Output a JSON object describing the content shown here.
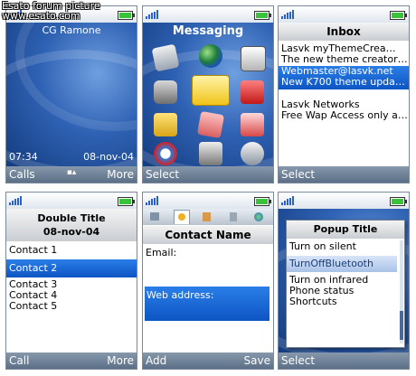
{
  "watermark": {
    "line1": "Esato forum picture",
    "line2": "www.esato.com"
  },
  "standby": {
    "operator": "CG Ramone",
    "time": "07:34",
    "date": "08-nov-04",
    "left_soft": "Calls",
    "right_soft": "More"
  },
  "messaging": {
    "title": "Messaging",
    "left_soft": "Select",
    "icons": [
      "contacts-icon",
      "globe-icon",
      "media-player-icon",
      "camera-icon",
      "envelope-icon",
      "organizer-icon",
      "folder-icon",
      "notes-icon",
      "calculator-icon",
      "sync-icon",
      "fm-radio-icon",
      "settings-icon"
    ]
  },
  "inbox": {
    "title": "Inbox",
    "items": [
      {
        "line1": "Lasvk myThemeCrea…",
        "line2": "The new theme creator…"
      },
      {
        "line1": "Webmaster@lasvk.net",
        "line2": "New K700 theme upda…"
      },
      {
        "line1": "Lasvk Networks",
        "line2": "Free Wap Access only a…"
      }
    ],
    "left_soft": "Select"
  },
  "double_title": {
    "title_line1": "Double Title",
    "title_line2": "08-nov-04",
    "contacts": [
      "Contact 1",
      "Contact 2",
      "Contact 3",
      "Contact 4",
      "Contact 5"
    ],
    "left_soft": "Call",
    "right_soft": "More"
  },
  "contact_name": {
    "title": "Contact Name",
    "tabs": [
      "card-tab-icon",
      "person-tab-icon",
      "note-tab-icon",
      "doc-tab-icon",
      "globe-tab-icon"
    ],
    "email_label": "Email:",
    "web_label": "Web address:",
    "left_soft": "Add",
    "right_soft": "Save"
  },
  "popup": {
    "title": "Popup Title",
    "items": [
      "Turn on silent",
      "TurnOffBluetooth",
      "Turn on infrared",
      "Phone status",
      "Shortcuts"
    ],
    "left_soft": "Select"
  },
  "colors": {
    "accent": "#1565d8",
    "softkey": "#6b7f96",
    "wallpaper": "#2f62b4"
  }
}
